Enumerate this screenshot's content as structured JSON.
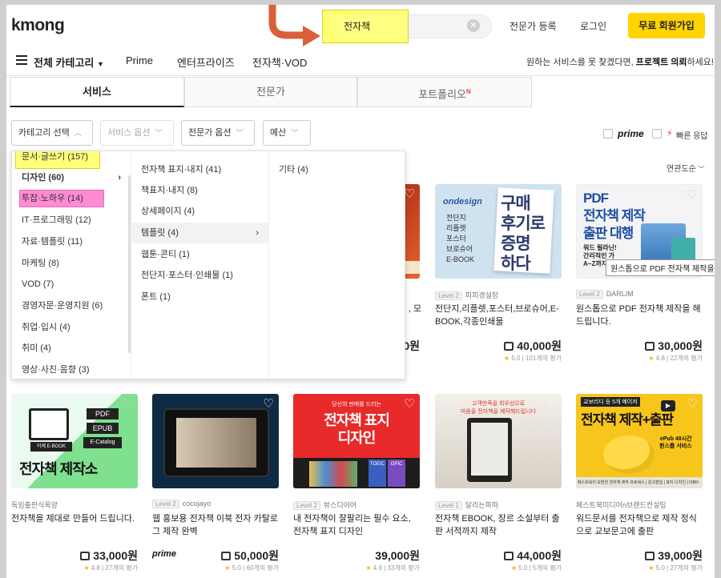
{
  "header": {
    "logo": "kmong",
    "search_value": "전자책",
    "links": [
      "전문가 등록",
      "로그인"
    ],
    "signup": "무료 회원가입"
  },
  "nav": {
    "all_categories": "전체 카테고리",
    "items": [
      "Prime",
      "엔터프라이즈",
      "전자책·VOD"
    ],
    "right_prefix": "원하는 서비스를 못 찾겠다면, ",
    "right_bold": "프로젝트 의뢰",
    "right_suffix": "하세요!"
  },
  "tabs": [
    {
      "label": "서비스"
    },
    {
      "label": "전문가"
    },
    {
      "label": "포트폴리오",
      "badge": "N"
    }
  ],
  "filters": {
    "items": [
      "카테고리 선택",
      "서비스 옵션",
      "전문가 옵션",
      "예산"
    ],
    "prime": "prime",
    "quick": "빠른 응답",
    "sort": "연관도순"
  },
  "dropdown": {
    "col1": [
      "문서·글쓰기 (157)",
      "디자인 (60)",
      "투잡·노하우 (14)",
      "IT·프로그래밍 (12)",
      "자료·템플릿 (11)",
      "마케팅 (8)",
      "VOD (7)",
      "경영자문·운영지원 (6)",
      "취업·입시 (4)",
      "취미 (4)",
      "영상·사진·음향 (3)"
    ],
    "col2": [
      "전자책 표지·내지 (41)",
      "책표지·내지 (8)",
      "상세페이지 (4)",
      "템플릿 (4)",
      "웹툰·콘티 (1)",
      "전단지·포스터·인쇄물 (1)",
      "폰트 (1)"
    ],
    "col3": [
      "기타 (4)"
    ]
  },
  "tooltip": "원스톱으로 PDF 전자책 제작을",
  "row1": [
    {
      "seller": "",
      "title_line1": ", 모",
      "title_line2": "",
      "price": "0원"
    },
    {
      "level": "Level 2",
      "seller": "피피경설장",
      "title": "전단지,리플렛,포스터,브로슈어,E-BOOK,각종인쇄물",
      "price": "40,000원",
      "score": "5.0",
      "reviews": "101개의 평가",
      "img": "구매\n후기로\n증명\n하다",
      "img_tag": "ondesign",
      "img_side": "전단지\n리플렛\n포스터\n브로슈어\nE-BOOK"
    },
    {
      "level": "Level 2",
      "seller": "DARLIM",
      "title": "원스톱으로 PDF 전자책 제작을 해 드립니다.",
      "price": "30,000원",
      "score": "4.8",
      "reviews": "22개의 평가",
      "img": "PDF\n전자책 제작\n출판 대행",
      "img_sub": "워드 될라닌!\n간리적인 가\nA~Z까지 한큐"
    }
  ],
  "row2": [
    {
      "seller": "독임출판식목양",
      "title": "전자책을 제대로 만들어 드립니다.",
      "price": "33,000원",
      "score": "4.8",
      "reviews": "27개의 평가",
      "img_tags": [
        "PDF",
        "EPUB",
        "E-Catalog"
      ],
      "img_book": "이제 E-BOOK",
      "img_big": "전자책 제작소"
    },
    {
      "level": "Level 2",
      "seller": "cocojayo",
      "title": "웹 홍보용 전자책 이북 전자 카탈로그 제작 완벽",
      "price": "50,000원",
      "score": "5.0",
      "reviews": "60개의 평가",
      "prime": "prime"
    },
    {
      "level": "Level 2",
      "seller": "뷰스디어어",
      "title": "내 전자책이 잘팔리는 필수 요소, 전자책 표지 디자인",
      "price": "39,000원",
      "score": "4.9",
      "reviews": "33개의 평가",
      "img_top": "당신의 판매를 드리는",
      "img_big": "전자책 표지\n디자인",
      "img_books": [
        "TOEIC",
        "OPIC",
        "TOEIC"
      ]
    },
    {
      "level": "Level 1",
      "seller": "달리는파파",
      "title": "전자책 EBOOK, 장르 소설부터 출판 서적까지 제작",
      "price": "44,000원",
      "score": "5.0",
      "reviews": "5개의 평가",
      "img_top": "고객만족을 최우선으로\n마음을 전자책을 제작해드립니다"
    },
    {
      "seller": "페스트북미디어n브랜드컨설팅",
      "title": "워드문서를 전자책으로 제작 정식으로 교보문고에 출판",
      "price": "39,000원",
      "score": "5.0",
      "reviews": "27개의 평가",
      "img_top": "교보리디 등 5개 메이저",
      "img_big": "전자책 제작+출판",
      "img_badge": "ePub 48시간\n원스톱 서비스",
      "img_bottom": "페스트북이 보장한 전자책 제작 프로세스 | 원고편집 | 표지·디자인 | ISBN"
    }
  ],
  "colors": {
    "accent": "#ffd400",
    "arrow": "#d9603b",
    "hl_yellow": "#ffff7a",
    "hl_pink": "#ff8bd4",
    "star": "#f7b500"
  }
}
